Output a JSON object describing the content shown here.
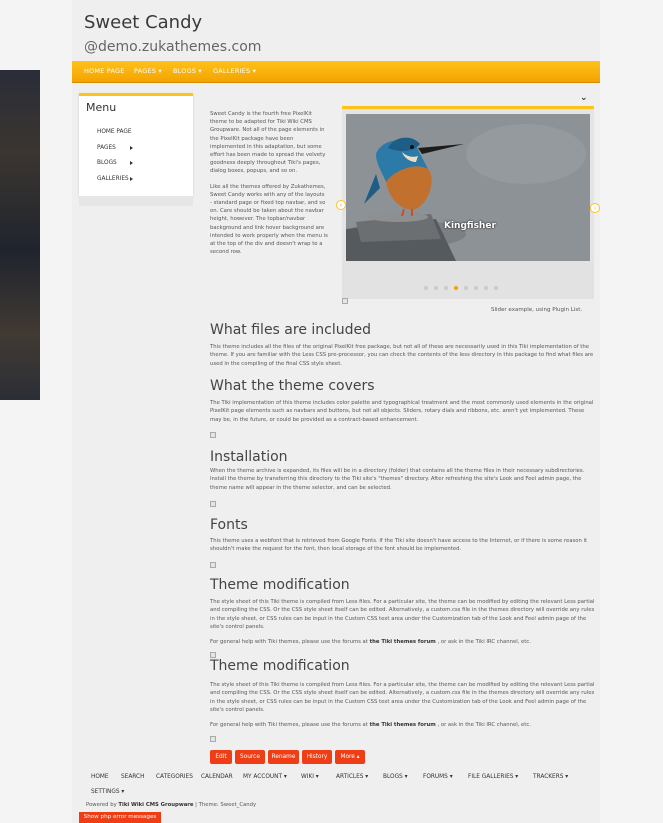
{
  "site": {
    "title": "Sweet Candy",
    "subtitle": "@demo.zukathemes.com"
  },
  "topnav": [
    "HOME PAGE",
    "PAGES ▾",
    "BLOGS ▾",
    "GALLERIES ▾"
  ],
  "menu": {
    "title": "Menu",
    "items": [
      "HOME PAGE",
      "PAGES",
      "BLOGS",
      "GALLERIES"
    ]
  },
  "intro": {
    "p1": "Sweet Candy is the fourth free PixelKit theme to be adapted for Tiki Wiki CMS Groupware. Not all of the page elements in the PixelKit package have been implemented in this adaptation, but some effort has been made to spread the velvety goodness deeply throughout Tiki's pages, dialog boxes, popups, and so on.",
    "p2": "Like all the themes offered by Zukathemes, Sweet Candy works with any of the layouts - standard page or fixed top navbar, and so on. Care should be taken about the navbar height, however. The topbar/navbar background and link hover background are intended to work properly when the menu is at the top of the div and doesn't wrap to a second row."
  },
  "slider": {
    "caption": "Kingfisher",
    "note": "Slider example, using Plugin List.",
    "active_dot": 3,
    "dot_count": 8
  },
  "sections": [
    {
      "heading": "What files are included",
      "text": "This theme includes all the files of the original PixelKit free package, but not all of these are necessarily used in this Tiki implementation of the theme. If you are familiar with the Less CSS pre-processor, you can check the contents of the less directory in this package to find what files are used in the compiling of the final CSS style sheet."
    },
    {
      "heading": "What the theme covers",
      "text": "The Tiki implementation of this theme includes color palette and typographical treatment and the most commonly used elements in the original PixelKit page elements such as navbars and buttons, but not all objects. Sliders, rotary dials and ribbons, etc. aren't yet implemented. These may be, in the future, or could be provided as a contract-based enhancement."
    },
    {
      "heading": "Installation",
      "text": "When the theme archive is expanded, its files will be in a directory (folder) that contains all the theme files in their necessary subdirectories. Install the theme by transferring this directory to the Tiki site's \"themes\" directory. After refreshing the site's Look and Feel admin page, the theme name will appear in the theme selector, and can be selected."
    },
    {
      "heading": "Fonts",
      "text": "This theme uses a webfont that is retrieved from Google Fonts. If the Tiki site doesn't have access to the Internet, or if there is some reason it shouldn't make the request for the font, then local storage of the font should be implemented."
    },
    {
      "heading": "Theme modification",
      "text": "The style sheet of this Tiki theme is compiled from Less files. For a particular site, the theme can be modified by editing the relevant Less partial and compiling the CSS. Or the CSS style sheet itself can be edited. Alternatively, a custom.css file in the themes directory will override any rules in the style sheet, or CSS rules can be input in the Custom CSS text area under the Customization tab of the Look and Feel admin page of the site's control panels.",
      "help_before": "For general help with Tiki themes, please use the forums at ",
      "help_link": "the Tiki themes forum",
      "help_after": " , or ask in the Tiki IRC channel, etc."
    },
    {
      "heading": "Theme modification",
      "text": "The style sheet of this Tiki theme is compiled from Less files. For a particular site, the theme can be modified by editing the relevant Less partial and compiling the CSS. Or the CSS style sheet itself can be edited. Alternatively, a custom.css file in the themes directory will override any rules in the style sheet, or CSS rules can be input in the Custom CSS text area under the Customization tab of the Look and Feel admin page of the site's control panels.",
      "help_before": "For general help with Tiki themes, please use the forums at ",
      "help_link": "the Tiki themes forum",
      "help_after": " , or ask in the Tiki IRC channel, etc."
    }
  ],
  "page_buttons": [
    "Edit",
    "Source",
    "Rename",
    "History",
    "More ▴"
  ],
  "bottom_nav": [
    "HOME",
    "SEARCH",
    "CATEGORIES",
    "CALENDAR",
    "MY ACCOUNT ▾",
    "WIKI ▾",
    "ARTICLES ▾",
    "BLOGS ▾",
    "FORUMS ▾",
    "FILE GALLERIES ▾",
    "TRACKERS ▾",
    "SETTINGS ▾"
  ],
  "footer": {
    "powered_prefix": "Powered by ",
    "powered_link": "Tiki Wiki CMS Groupware",
    "powered_suffix": "  |  Theme: Sweet_Candy",
    "php_button": "Show php error messages"
  },
  "colors": {
    "accent": "#ffc21a",
    "button": "#ef3d16"
  }
}
